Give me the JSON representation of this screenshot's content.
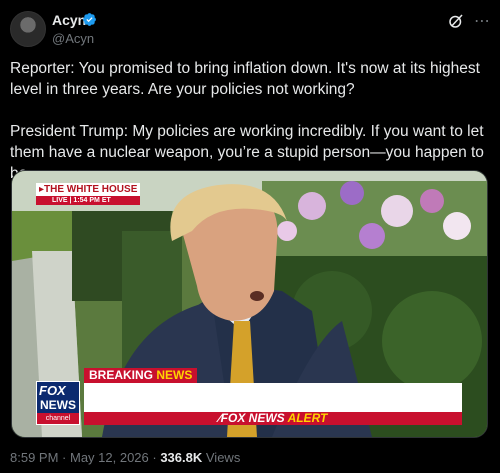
{
  "author": {
    "name": "Acyn",
    "handle": "@Acyn",
    "verified": true
  },
  "tweet": {
    "text_line1": "Reporter: You promised to bring inflation down. It's now at its highest level in three years. Are your policies not working?",
    "text_line2": "President Trump: My policies are working incredibly. If you want to let them have a nuclear weapon, you’re a stupid person—you happen to be."
  },
  "media": {
    "chyron_location": "THE WHITE HOUSE",
    "chyron_live": "LIVE",
    "chyron_time": "1:54 PM ET",
    "breaking_word1": "BREAKING",
    "breaking_word2": "NEWS",
    "alert_brand": "FOX NEWS",
    "alert_word": "ALERT",
    "logo_line1": "FOX",
    "logo_line2": "NEWS",
    "logo_line3": "channel"
  },
  "meta": {
    "time": "8:59 PM",
    "date": "May 12, 2026",
    "views_count": "336.8K",
    "views_label": "Views"
  },
  "icons": {
    "verified": "verified-badge-icon",
    "grok": "grok-icon",
    "more": "more-icon"
  },
  "colors": {
    "verified": "#1d9bf0",
    "fox_red": "#c8102e",
    "fox_blue": "#0b2a6f",
    "accent_yellow": "#ffd400"
  }
}
